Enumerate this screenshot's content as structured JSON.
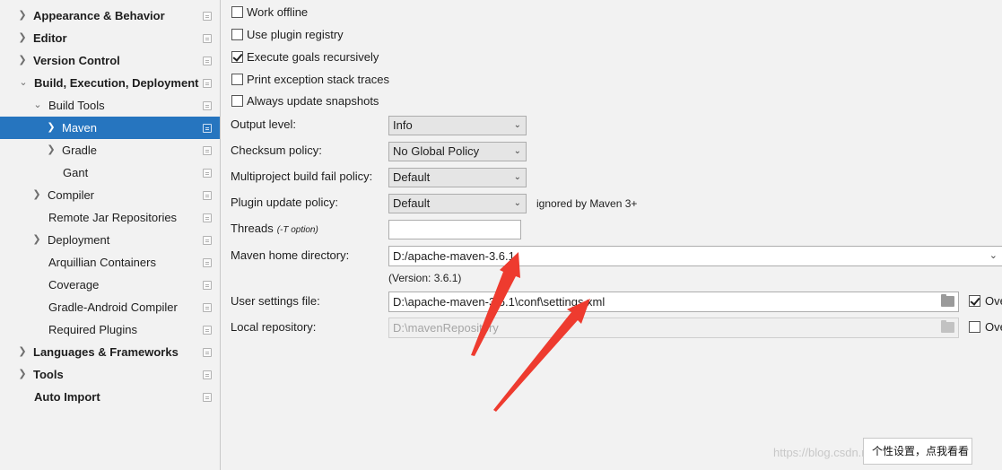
{
  "sidebar": {
    "items": [
      {
        "label": "Appearance & Behavior",
        "chevron": "right",
        "bold": true,
        "selected": false
      },
      {
        "label": "Editor",
        "chevron": "right",
        "bold": true,
        "selected": false
      },
      {
        "label": "Version Control",
        "chevron": "right",
        "bold": true,
        "selected": false
      },
      {
        "label": "Build, Execution, Deployment",
        "chevron": "down",
        "bold": true,
        "selected": false
      },
      {
        "label": "Build Tools",
        "chevron": "down",
        "bold": false,
        "selected": false
      },
      {
        "label": "Maven",
        "chevron": "right",
        "bold": false,
        "selected": true
      },
      {
        "label": "Gradle",
        "chevron": "right",
        "bold": false,
        "selected": false
      },
      {
        "label": "Gant",
        "chevron": "",
        "bold": false,
        "selected": false
      },
      {
        "label": "Compiler",
        "chevron": "right",
        "bold": false,
        "selected": false
      },
      {
        "label": "Remote Jar Repositories",
        "chevron": "",
        "bold": false,
        "selected": false
      },
      {
        "label": "Deployment",
        "chevron": "right",
        "bold": false,
        "selected": false
      },
      {
        "label": "Arquillian Containers",
        "chevron": "",
        "bold": false,
        "selected": false
      },
      {
        "label": "Coverage",
        "chevron": "",
        "bold": false,
        "selected": false
      },
      {
        "label": "Gradle-Android Compiler",
        "chevron": "",
        "bold": false,
        "selected": false
      },
      {
        "label": "Required Plugins",
        "chevron": "",
        "bold": false,
        "selected": false
      },
      {
        "label": "Languages & Frameworks",
        "chevron": "right",
        "bold": true,
        "selected": false
      },
      {
        "label": "Tools",
        "chevron": "right",
        "bold": true,
        "selected": false
      },
      {
        "label": "Auto Import",
        "chevron": "",
        "bold": true,
        "selected": false
      }
    ]
  },
  "maven": {
    "checkboxes": [
      {
        "label": "Work offline",
        "checked": false
      },
      {
        "label": "Use plugin registry",
        "checked": false
      },
      {
        "label": "Execute goals recursively",
        "checked": true
      },
      {
        "label": "Print exception stack traces",
        "checked": false
      },
      {
        "label": "Always update snapshots",
        "checked": false
      }
    ],
    "output_level": {
      "label": "Output level:",
      "value": "Info"
    },
    "checksum_policy": {
      "label": "Checksum policy:",
      "value": "No Global Policy"
    },
    "multiproject_fail_policy": {
      "label": "Multiproject build fail policy:",
      "value": "Default"
    },
    "plugin_update_policy": {
      "label": "Plugin update policy:",
      "value": "Default",
      "note": "ignored by Maven 3+"
    },
    "threads": {
      "label": "Threads",
      "hint": "(-T option)",
      "value": ""
    },
    "home_directory": {
      "label": "Maven home directory:",
      "value": "D:/apache-maven-3.6.1",
      "version": "(Version: 3.6.1)"
    },
    "user_settings": {
      "label": "User settings file:",
      "value": "D:\\apache-maven-3.6.1\\conf\\settings.xml",
      "override_label": "Ove",
      "override_checked": true
    },
    "local_repository": {
      "label": "Local repository:",
      "value": "D:\\mavenRepository",
      "override_label": "Ove",
      "override_checked": false
    }
  },
  "tooltip": {
    "text": "个性设置，点我看看"
  },
  "watermark": {
    "text": "https://blog.csdn.net/...357"
  },
  "colors": {
    "selection": "#2675bf",
    "arrow": "#ee3b2f"
  },
  "icons": {
    "arrow": "chevron-icon",
    "page": "page-icon",
    "folder": "folder-icon"
  }
}
